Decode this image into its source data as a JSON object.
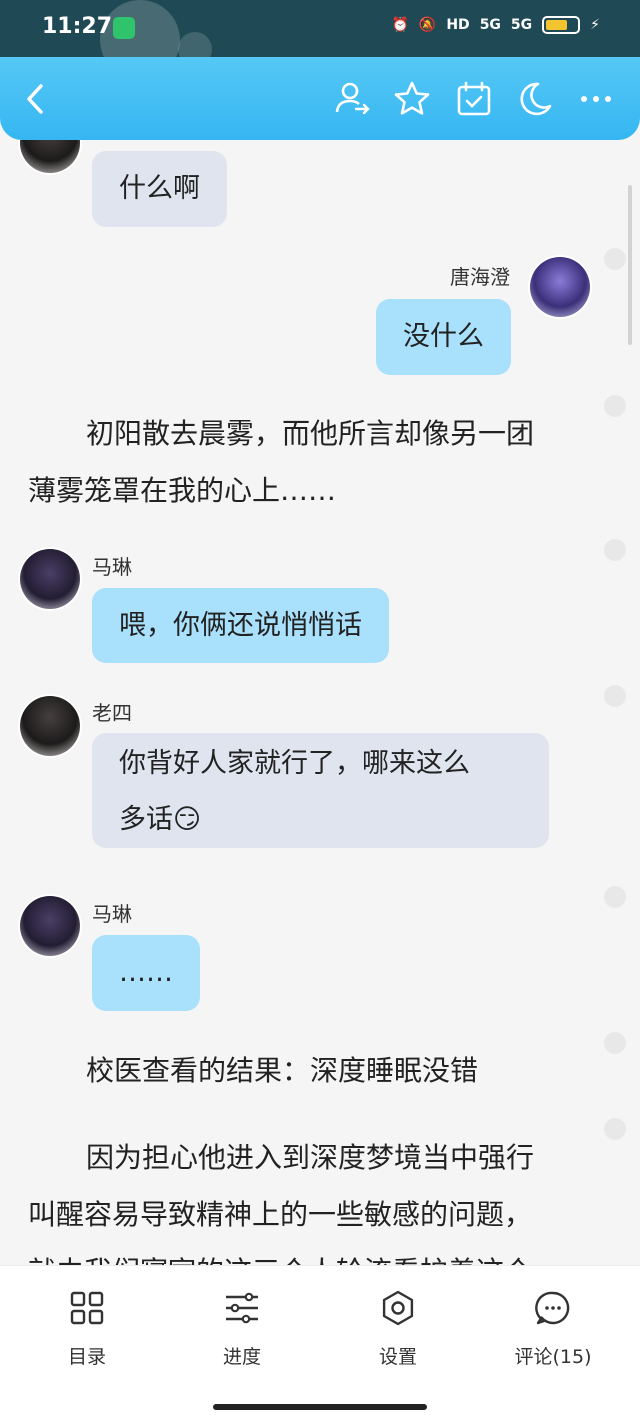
{
  "status_bar": {
    "time": "11:27",
    "net1": "HD",
    "net2": "5G",
    "net3": "5G",
    "battery_level": 0.6
  },
  "toolbar": {
    "back_icon": "chevron-left-icon",
    "icons": [
      "user-switch-icon",
      "star-icon",
      "calendar-check-icon",
      "moon-icon",
      "more-icon"
    ]
  },
  "chat": [
    {
      "side": "left",
      "bubble_style": "gray",
      "text": "什么啊"
    },
    {
      "side": "right",
      "speaker": "唐海澄",
      "bubble_style": "blue",
      "text": "没什么"
    },
    {
      "narration": [
        "初阳散去晨雾，而他所言却像另一团",
        "薄雾笼罩在我的心上……"
      ]
    },
    {
      "side": "left",
      "speaker": "马琳",
      "bubble_style": "blue",
      "text": "喂，你俩还说悄悄话"
    },
    {
      "side": "left",
      "speaker": "老四",
      "bubble_style": "gray",
      "text_lines": [
        "你背好人家就行了，哪来这么",
        "多话😏"
      ]
    },
    {
      "side": "left",
      "speaker": "马琳",
      "bubble_style": "blue",
      "text": "……"
    },
    {
      "narration": [
        "校医查看的结果：深度睡眠没错"
      ]
    },
    {
      "narration": [
        "因为担心他进入到深度梦境当中强行",
        "叫醒容易导致精神上的一些敏感的问题，",
        "就由我们寝室的这三个人轮流看护着这个"
      ]
    }
  ],
  "bottom_nav": [
    {
      "label": "目录",
      "icon": "catalog-icon"
    },
    {
      "label": "进度",
      "icon": "progress-sliders-icon"
    },
    {
      "label": "设置",
      "icon": "settings-gear-icon"
    },
    {
      "label": "评论(15)",
      "icon": "comment-icon"
    }
  ]
}
